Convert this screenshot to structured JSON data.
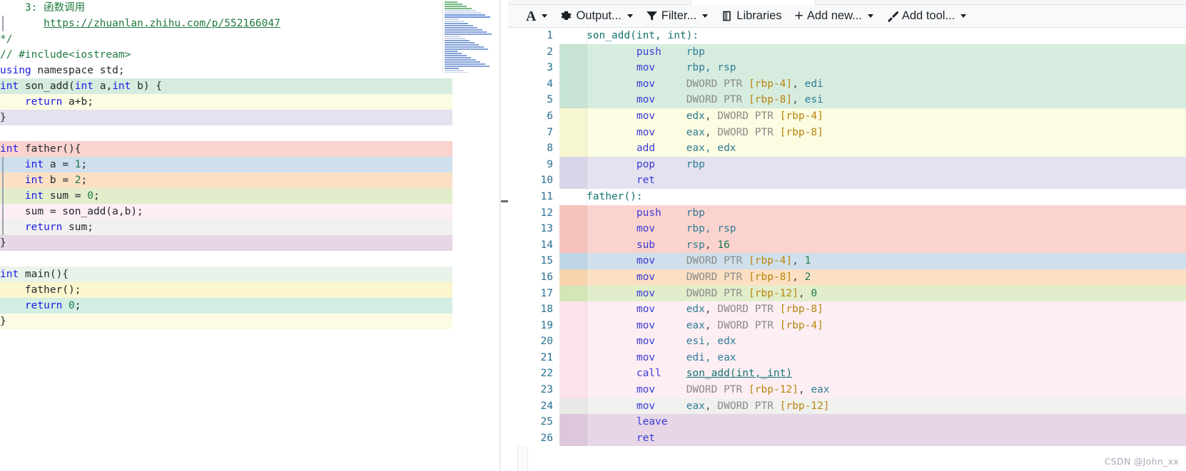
{
  "source_pane": {
    "name": "cpp-source-editor",
    "lines": [
      {
        "bg": "#ffffff",
        "fold": false,
        "tokens": [
          {
            "t": "    3: ",
            "c": "cmt"
          },
          {
            "t": "函数调用",
            "c": "cmt"
          }
        ]
      },
      {
        "bg": "#ffffff",
        "fold": true,
        "tokens": [
          {
            "t": "       ",
            "c": "plain"
          },
          {
            "t": "https://zhuanlan.zhihu.com/p/552166047",
            "c": "link"
          }
        ]
      },
      {
        "bg": "#ffffff",
        "fold": false,
        "tokens": [
          {
            "t": "*/",
            "c": "cmt"
          }
        ]
      },
      {
        "bg": "#ffffff",
        "fold": false,
        "tokens": [
          {
            "t": "// #include<iostream>",
            "c": "cmt"
          }
        ]
      },
      {
        "bg": "#ffffff",
        "fold": false,
        "tokens": [
          {
            "t": "using",
            "c": "kw"
          },
          {
            "t": " namespace ",
            "c": "plain"
          },
          {
            "t": "std;",
            "c": "plain"
          }
        ]
      },
      {
        "bg": "#d6ecdf",
        "fold": false,
        "tokens": [
          {
            "t": "int",
            "c": "type"
          },
          {
            "t": " son_add(",
            "c": "plain"
          },
          {
            "t": "int",
            "c": "type"
          },
          {
            "t": " a,",
            "c": "plain"
          },
          {
            "t": "int",
            "c": "type"
          },
          {
            "t": " b) {",
            "c": "plain"
          }
        ]
      },
      {
        "bg": "#fcfce2",
        "fold": false,
        "tokens": [
          {
            "t": "    ",
            "c": "plain"
          },
          {
            "t": "return",
            "c": "kw"
          },
          {
            "t": " a+b;",
            "c": "plain"
          }
        ]
      },
      {
        "bg": "#e4e2ef",
        "fold": false,
        "tokens": [
          {
            "t": "}",
            "c": "plain"
          }
        ]
      },
      {
        "bg": "#ffffff",
        "fold": false,
        "tokens": [
          {
            "t": "",
            "c": "plain"
          }
        ]
      },
      {
        "bg": "#fbd3ce",
        "fold": false,
        "tokens": [
          {
            "t": "int",
            "c": "type"
          },
          {
            "t": " father(){",
            "c": "plain"
          }
        ]
      },
      {
        "bg": "#cfe0ec",
        "fold": true,
        "tokens": [
          {
            "t": "    ",
            "c": "plain"
          },
          {
            "t": "int",
            "c": "type"
          },
          {
            "t": " a = ",
            "c": "plain"
          },
          {
            "t": "1",
            "c": "num"
          },
          {
            "t": ";",
            "c": "plain"
          }
        ]
      },
      {
        "bg": "#fbe0c3",
        "fold": true,
        "tokens": [
          {
            "t": "    ",
            "c": "plain"
          },
          {
            "t": "int",
            "c": "type"
          },
          {
            "t": " b = ",
            "c": "plain"
          },
          {
            "t": "2",
            "c": "num"
          },
          {
            "t": ";",
            "c": "plain"
          }
        ]
      },
      {
        "bg": "#e2eecb",
        "fold": true,
        "tokens": [
          {
            "t": "    ",
            "c": "plain"
          },
          {
            "t": "int",
            "c": "type"
          },
          {
            "t": " sum = ",
            "c": "plain"
          },
          {
            "t": "0",
            "c": "num"
          },
          {
            "t": ";",
            "c": "plain"
          }
        ]
      },
      {
        "bg": "#fdeef4",
        "fold": true,
        "tokens": [
          {
            "t": "    sum = son_add(a,b);",
            "c": "plain"
          }
        ]
      },
      {
        "bg": "#f0f0ef",
        "fold": true,
        "tokens": [
          {
            "t": "    ",
            "c": "plain"
          },
          {
            "t": "return",
            "c": "kw"
          },
          {
            "t": " sum;",
            "c": "plain"
          }
        ]
      },
      {
        "bg": "#e6d6e6",
        "fold": false,
        "tokens": [
          {
            "t": "}",
            "c": "plain"
          }
        ]
      },
      {
        "bg": "#ffffff",
        "fold": false,
        "tokens": [
          {
            "t": "",
            "c": "plain"
          }
        ]
      },
      {
        "bg": "#e9f3e9",
        "fold": false,
        "tokens": [
          {
            "t": "int",
            "c": "type"
          },
          {
            "t": " main(){",
            "c": "plain"
          }
        ]
      },
      {
        "bg": "#fcf6cf",
        "fold": false,
        "tokens": [
          {
            "t": "    father();",
            "c": "plain"
          }
        ]
      },
      {
        "bg": "#d3eee3",
        "fold": false,
        "tokens": [
          {
            "t": "    ",
            "c": "plain"
          },
          {
            "t": "return",
            "c": "kw"
          },
          {
            "t": " ",
            "c": "plain"
          },
          {
            "t": "0",
            "c": "num"
          },
          {
            "t": ";",
            "c": "plain"
          }
        ]
      },
      {
        "bg": "#fbfbe6",
        "fold": false,
        "tokens": [
          {
            "t": "}",
            "c": "plain"
          }
        ]
      }
    ]
  },
  "toolbar": {
    "name": "compiler-toolbar",
    "items": [
      {
        "icon": "font-size-icon",
        "glyph": "A",
        "label": "",
        "caret": true
      },
      {
        "icon": "gear-icon",
        "glyph": "",
        "label": "Output...",
        "caret": true
      },
      {
        "icon": "filter-icon",
        "glyph": "",
        "label": "Filter...",
        "caret": true
      },
      {
        "icon": "libraries-icon",
        "glyph": "",
        "label": "Libraries",
        "caret": false
      },
      {
        "icon": "plus-icon",
        "glyph": "+",
        "label": "Add new...",
        "caret": true
      },
      {
        "icon": "wand-icon",
        "glyph": "",
        "label": "Add tool...",
        "caret": true
      }
    ]
  },
  "asm_pane": {
    "name": "assembly-output",
    "rows": [
      {
        "n": "1",
        "bg": "#ffffff",
        "gut": "#ffffff",
        "tokens": [
          {
            "t": "son_add(int, int):",
            "c": "label"
          }
        ]
      },
      {
        "n": "2",
        "bg": "#d6ecdf",
        "gut": "#c6e3d4",
        "tokens": [
          {
            "t": "        ",
            "c": "punct"
          },
          {
            "t": "push",
            "c": "mn"
          },
          {
            "t": "    ",
            "c": "punct"
          },
          {
            "t": "rbp",
            "c": "reg"
          }
        ]
      },
      {
        "n": "3",
        "bg": "#d6ecdf",
        "gut": "#c6e3d4",
        "tokens": [
          {
            "t": "        ",
            "c": "punct"
          },
          {
            "t": "mov",
            "c": "mn"
          },
          {
            "t": "     ",
            "c": "punct"
          },
          {
            "t": "rbp, rsp",
            "c": "reg"
          }
        ]
      },
      {
        "n": "4",
        "bg": "#d6ecdf",
        "gut": "#c6e3d4",
        "tokens": [
          {
            "t": "        ",
            "c": "punct"
          },
          {
            "t": "mov",
            "c": "mn"
          },
          {
            "t": "     ",
            "c": "punct"
          },
          {
            "t": "DWORD PTR ",
            "c": "kw"
          },
          {
            "t": "[rbp-4]",
            "c": "brk"
          },
          {
            "t": ", ",
            "c": "punct"
          },
          {
            "t": "edi",
            "c": "reg"
          }
        ]
      },
      {
        "n": "5",
        "bg": "#d6ecdf",
        "gut": "#c6e3d4",
        "tokens": [
          {
            "t": "        ",
            "c": "punct"
          },
          {
            "t": "mov",
            "c": "mn"
          },
          {
            "t": "     ",
            "c": "punct"
          },
          {
            "t": "DWORD PTR ",
            "c": "kw"
          },
          {
            "t": "[rbp-8]",
            "c": "brk"
          },
          {
            "t": ", ",
            "c": "punct"
          },
          {
            "t": "esi",
            "c": "reg"
          }
        ]
      },
      {
        "n": "6",
        "bg": "#fcfce2",
        "gut": "#f6f6cf",
        "tokens": [
          {
            "t": "        ",
            "c": "punct"
          },
          {
            "t": "mov",
            "c": "mn"
          },
          {
            "t": "     ",
            "c": "punct"
          },
          {
            "t": "edx",
            "c": "reg"
          },
          {
            "t": ", ",
            "c": "punct"
          },
          {
            "t": "DWORD PTR ",
            "c": "kw"
          },
          {
            "t": "[rbp-4]",
            "c": "brk"
          }
        ]
      },
      {
        "n": "7",
        "bg": "#fcfce2",
        "gut": "#f6f6cf",
        "tokens": [
          {
            "t": "        ",
            "c": "punct"
          },
          {
            "t": "mov",
            "c": "mn"
          },
          {
            "t": "     ",
            "c": "punct"
          },
          {
            "t": "eax",
            "c": "reg"
          },
          {
            "t": ", ",
            "c": "punct"
          },
          {
            "t": "DWORD PTR ",
            "c": "kw"
          },
          {
            "t": "[rbp-8]",
            "c": "brk"
          }
        ]
      },
      {
        "n": "8",
        "bg": "#fcfce2",
        "gut": "#f6f6cf",
        "tokens": [
          {
            "t": "        ",
            "c": "punct"
          },
          {
            "t": "add",
            "c": "mn"
          },
          {
            "t": "     ",
            "c": "punct"
          },
          {
            "t": "eax, edx",
            "c": "reg"
          }
        ]
      },
      {
        "n": "9",
        "bg": "#e4e2ef",
        "gut": "#d8d5e8",
        "tokens": [
          {
            "t": "        ",
            "c": "punct"
          },
          {
            "t": "pop",
            "c": "mn"
          },
          {
            "t": "     ",
            "c": "punct"
          },
          {
            "t": "rbp",
            "c": "reg"
          }
        ]
      },
      {
        "n": "10",
        "bg": "#e4e2ef",
        "gut": "#d8d5e8",
        "tokens": [
          {
            "t": "        ",
            "c": "punct"
          },
          {
            "t": "ret",
            "c": "mn"
          }
        ]
      },
      {
        "n": "11",
        "bg": "#ffffff",
        "gut": "#ffffff",
        "tokens": [
          {
            "t": "father():",
            "c": "label"
          }
        ]
      },
      {
        "n": "12",
        "bg": "#fbd3ce",
        "gut": "#f7c2bb",
        "tokens": [
          {
            "t": "        ",
            "c": "punct"
          },
          {
            "t": "push",
            "c": "mn"
          },
          {
            "t": "    ",
            "c": "punct"
          },
          {
            "t": "rbp",
            "c": "reg"
          }
        ]
      },
      {
        "n": "13",
        "bg": "#fbd3ce",
        "gut": "#f7c2bb",
        "tokens": [
          {
            "t": "        ",
            "c": "punct"
          },
          {
            "t": "mov",
            "c": "mn"
          },
          {
            "t": "     ",
            "c": "punct"
          },
          {
            "t": "rbp, rsp",
            "c": "reg"
          }
        ]
      },
      {
        "n": "14",
        "bg": "#fbd3ce",
        "gut": "#f7c2bb",
        "tokens": [
          {
            "t": "        ",
            "c": "punct"
          },
          {
            "t": "sub",
            "c": "mn"
          },
          {
            "t": "     ",
            "c": "punct"
          },
          {
            "t": "rsp",
            "c": "reg"
          },
          {
            "t": ", ",
            "c": "punct"
          },
          {
            "t": "16",
            "c": "num"
          }
        ]
      },
      {
        "n": "15",
        "bg": "#cfe0ec",
        "gut": "#bdd5e6",
        "tokens": [
          {
            "t": "        ",
            "c": "punct"
          },
          {
            "t": "mov",
            "c": "mn"
          },
          {
            "t": "     ",
            "c": "punct"
          },
          {
            "t": "DWORD PTR ",
            "c": "kw"
          },
          {
            "t": "[rbp-4]",
            "c": "brk"
          },
          {
            "t": ", ",
            "c": "punct"
          },
          {
            "t": "1",
            "c": "num"
          }
        ]
      },
      {
        "n": "16",
        "bg": "#fbe0c3",
        "gut": "#f7d4ae",
        "tokens": [
          {
            "t": "        ",
            "c": "punct"
          },
          {
            "t": "mov",
            "c": "mn"
          },
          {
            "t": "     ",
            "c": "punct"
          },
          {
            "t": "DWORD PTR ",
            "c": "kw"
          },
          {
            "t": "[rbp-8]",
            "c": "brk"
          },
          {
            "t": ", ",
            "c": "punct"
          },
          {
            "t": "2",
            "c": "num"
          }
        ]
      },
      {
        "n": "17",
        "bg": "#e2eecb",
        "gut": "#d4e6b6",
        "tokens": [
          {
            "t": "        ",
            "c": "punct"
          },
          {
            "t": "mov",
            "c": "mn"
          },
          {
            "t": "     ",
            "c": "punct"
          },
          {
            "t": "DWORD PTR ",
            "c": "kw"
          },
          {
            "t": "[rbp-12]",
            "c": "brk"
          },
          {
            "t": ", ",
            "c": "punct"
          },
          {
            "t": "0",
            "c": "num"
          }
        ]
      },
      {
        "n": "18",
        "bg": "#fdeef4",
        "gut": "#fbe2ec",
        "tokens": [
          {
            "t": "        ",
            "c": "punct"
          },
          {
            "t": "mov",
            "c": "mn"
          },
          {
            "t": "     ",
            "c": "punct"
          },
          {
            "t": "edx",
            "c": "reg"
          },
          {
            "t": ", ",
            "c": "punct"
          },
          {
            "t": "DWORD PTR ",
            "c": "kw"
          },
          {
            "t": "[rbp-8]",
            "c": "brk"
          }
        ]
      },
      {
        "n": "19",
        "bg": "#fdeef4",
        "gut": "#fbe2ec",
        "tokens": [
          {
            "t": "        ",
            "c": "punct"
          },
          {
            "t": "mov",
            "c": "mn"
          },
          {
            "t": "     ",
            "c": "punct"
          },
          {
            "t": "eax",
            "c": "reg"
          },
          {
            "t": ", ",
            "c": "punct"
          },
          {
            "t": "DWORD PTR ",
            "c": "kw"
          },
          {
            "t": "[rbp-4]",
            "c": "brk"
          }
        ]
      },
      {
        "n": "20",
        "bg": "#fdeef4",
        "gut": "#fbe2ec",
        "tokens": [
          {
            "t": "        ",
            "c": "punct"
          },
          {
            "t": "mov",
            "c": "mn"
          },
          {
            "t": "     ",
            "c": "punct"
          },
          {
            "t": "esi, edx",
            "c": "reg"
          }
        ]
      },
      {
        "n": "21",
        "bg": "#fdeef4",
        "gut": "#fbe2ec",
        "tokens": [
          {
            "t": "        ",
            "c": "punct"
          },
          {
            "t": "mov",
            "c": "mn"
          },
          {
            "t": "     ",
            "c": "punct"
          },
          {
            "t": "edi, eax",
            "c": "reg"
          }
        ]
      },
      {
        "n": "22",
        "bg": "#fdeef4",
        "gut": "#fbe2ec",
        "tokens": [
          {
            "t": "        ",
            "c": "punct"
          },
          {
            "t": "call",
            "c": "mn"
          },
          {
            "t": "    ",
            "c": "punct"
          },
          {
            "t": "son_add(int,_int)",
            "c": "call"
          }
        ]
      },
      {
        "n": "23",
        "bg": "#fdeef4",
        "gut": "#fbe2ec",
        "tokens": [
          {
            "t": "        ",
            "c": "punct"
          },
          {
            "t": "mov",
            "c": "mn"
          },
          {
            "t": "     ",
            "c": "punct"
          },
          {
            "t": "DWORD PTR ",
            "c": "kw"
          },
          {
            "t": "[rbp-12]",
            "c": "brk"
          },
          {
            "t": ", ",
            "c": "punct"
          },
          {
            "t": "eax",
            "c": "reg"
          }
        ]
      },
      {
        "n": "24",
        "bg": "#f0f0ef",
        "gut": "#e8e8e6",
        "tokens": [
          {
            "t": "        ",
            "c": "punct"
          },
          {
            "t": "mov",
            "c": "mn"
          },
          {
            "t": "     ",
            "c": "punct"
          },
          {
            "t": "eax",
            "c": "reg"
          },
          {
            "t": ", ",
            "c": "punct"
          },
          {
            "t": "DWORD PTR ",
            "c": "kw"
          },
          {
            "t": "[rbp-12]",
            "c": "brk"
          }
        ]
      },
      {
        "n": "25",
        "bg": "#e6d6e6",
        "gut": "#dcc7dc",
        "tokens": [
          {
            "t": "        ",
            "c": "punct"
          },
          {
            "t": "leave",
            "c": "mn"
          }
        ]
      },
      {
        "n": "26",
        "bg": "#e6d6e6",
        "gut": "#dcc7dc",
        "tokens": [
          {
            "t": "        ",
            "c": "punct"
          },
          {
            "t": "ret",
            "c": "mn"
          }
        ]
      }
    ]
  },
  "watermark": {
    "text": "CSDN @John_xx"
  }
}
